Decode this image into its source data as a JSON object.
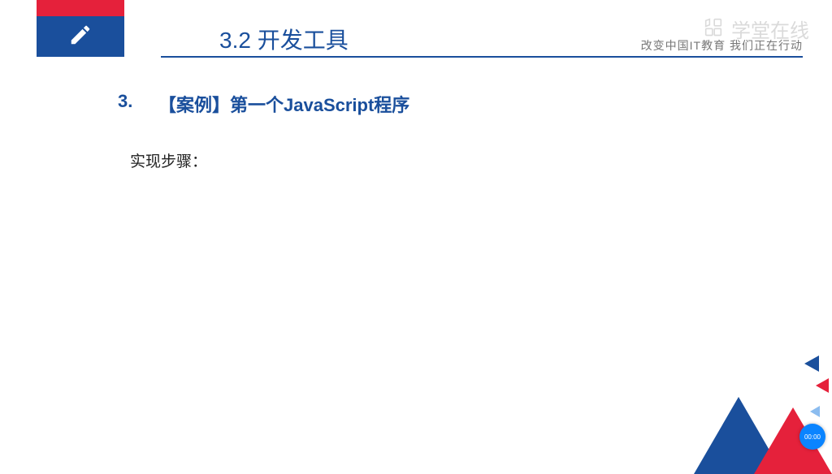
{
  "header": {
    "title": "3.2 开发工具",
    "subtitle": "改变中国IT教育 我们正在行动"
  },
  "watermark": {
    "text": "学堂在线",
    "icon": "grid-logo-icon"
  },
  "content": {
    "section_number": "3.",
    "section_title": "【案例】第一个JavaScript程序",
    "body": "实现步骤："
  },
  "footer": {
    "timestamp": "00:00"
  },
  "icons": {
    "pencil": "pencil-icon"
  },
  "colors": {
    "primary_blue": "#1a4f9c",
    "accent_red": "#e5213b"
  }
}
